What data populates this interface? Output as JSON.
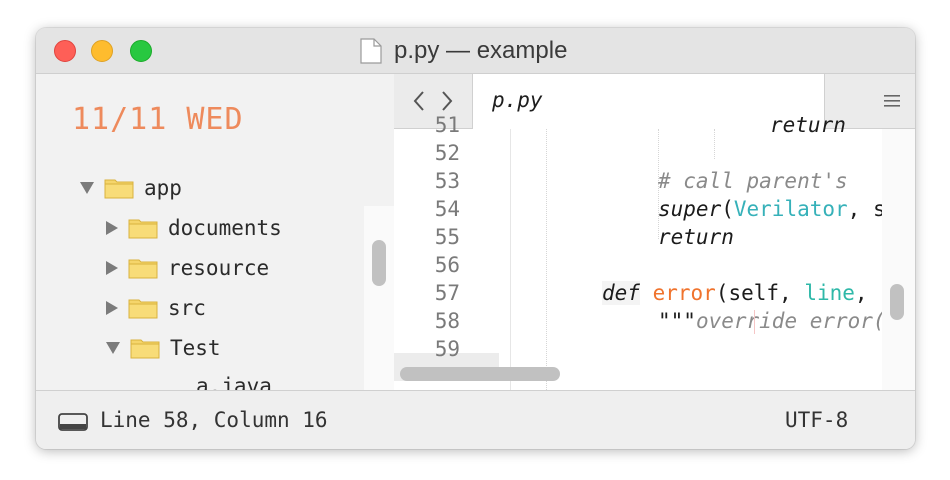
{
  "window": {
    "title": "p.py — example"
  },
  "sidebar": {
    "date": "11/11 WED",
    "tree": [
      {
        "label": "app",
        "state": "open"
      },
      {
        "label": "documents",
        "state": "closed"
      },
      {
        "label": "resource",
        "state": "closed"
      },
      {
        "label": "src",
        "state": "closed"
      },
      {
        "label": "Test",
        "state": "open"
      },
      {
        "label": "a.java",
        "state": "file"
      }
    ]
  },
  "editor": {
    "tab_label": "p.py",
    "line_numbers": [
      "51",
      "52",
      "53",
      "54",
      "55",
      "56",
      "57",
      "58",
      "59"
    ],
    "current_line": "58",
    "code": {
      "l51": "return",
      "l53": "# call parent's",
      "l54_fn": "super",
      "l54_p1": "(",
      "l54_cls": "Verilator",
      "l54_rest": ", se",
      "l55": "return",
      "l57_kw": "def",
      "l57_fn": "error",
      "l57_p1": "(self, ",
      "l57_param": "line",
      "l57_rest": ", c",
      "l58_q": "\"\"\"",
      "l58_cmt": "override error()"
    }
  },
  "statusbar": {
    "position": "Line 58, Column 16",
    "encoding": "UTF-8"
  },
  "colors": {
    "accent": "#ee8a5c",
    "folder": "#f5d56b"
  },
  "icons": [
    "document-icon",
    "back-chevron-icon",
    "forward-chevron-icon",
    "menu-icon",
    "folder-icon",
    "disclosure-arrow-icon",
    "panel-toggle-icon"
  ]
}
